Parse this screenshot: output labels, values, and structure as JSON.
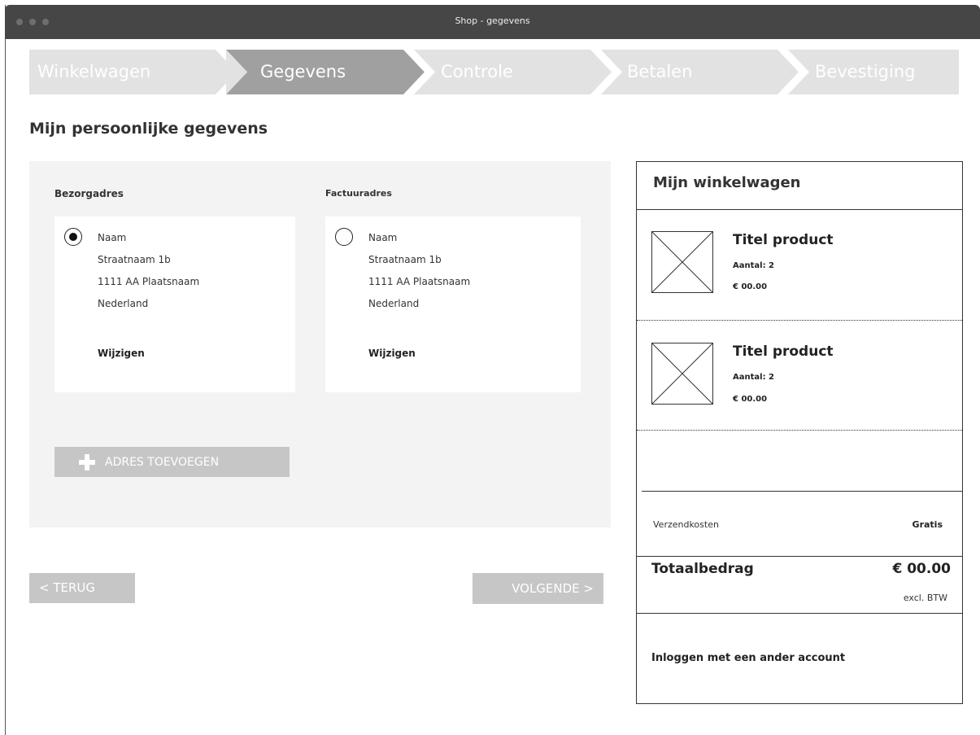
{
  "window": {
    "title": "Shop - gegevens"
  },
  "steps": [
    {
      "label": "Winkelwagen",
      "active": false
    },
    {
      "label": "Gegevens",
      "active": true
    },
    {
      "label": "Controle",
      "active": false
    },
    {
      "label": "Betalen",
      "active": false
    },
    {
      "label": "Bevestiging",
      "active": false
    }
  ],
  "page": {
    "title": "Mijn persoonlijke gegevens"
  },
  "delivery": {
    "heading": "Bezorgadres",
    "selected": true,
    "name": "Naam",
    "street": "Straatnaam 1b",
    "city": "1111 AA Plaatsnaam",
    "country": "Nederland",
    "edit_label": "Wijzigen"
  },
  "billing": {
    "heading": "Factuuradres",
    "selected": false,
    "name": "Naam",
    "street": "Straatnaam 1b",
    "city": "1111 AA Plaatsnaam",
    "country": "Nederland",
    "edit_label": "Wijzigen"
  },
  "add_address_label": "ADRES TOEVOEGEN",
  "nav": {
    "back_label": "< TERUG",
    "next_label": "VOLGENDE >"
  },
  "cart": {
    "title": "Mijn winkelwagen",
    "products": [
      {
        "title": "Titel product",
        "quantity": "Aantal: 2",
        "price": "€ 00.00"
      },
      {
        "title": "Titel product",
        "quantity": "Aantal: 2",
        "price": "€ 00.00"
      }
    ],
    "shipping_label": "Verzendkosten",
    "shipping_value": "Gratis",
    "total_label": "Totaalbedrag",
    "total_value": "€ 00.00",
    "total_note": "excl. BTW",
    "other_account_label": "Inloggen met een ander account"
  },
  "colors": {
    "titlebar": "#464646",
    "step_inactive": "#e2e2e2",
    "step_active": "#a0a0a0",
    "panel": "#f3f3f3",
    "button": "#c6c6c6"
  }
}
